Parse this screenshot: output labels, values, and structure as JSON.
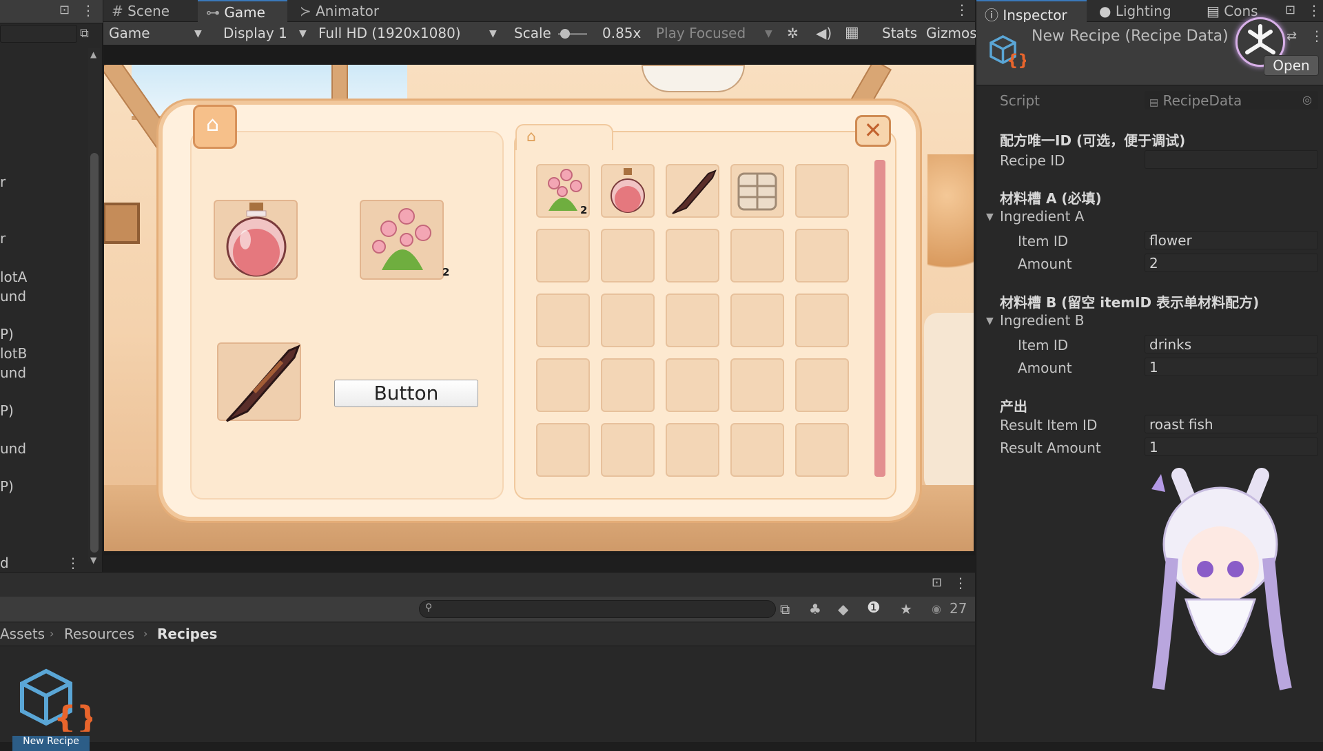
{
  "hierarchy": {
    "rows": [
      "r",
      "r",
      "lotA",
      "und",
      "P)",
      "lotB",
      "und",
      "P)",
      "und",
      "P)",
      "d"
    ]
  },
  "game_tabs": [
    {
      "label": "Scene",
      "icon": "grid-icon"
    },
    {
      "label": "Game",
      "icon": "gamepad-icon"
    },
    {
      "label": "Animator",
      "icon": "animator-icon"
    }
  ],
  "game_toolbar": {
    "view": "Game",
    "display": "Display 1",
    "resolution": "Full HD (1920x1080)",
    "scale_label": "Scale",
    "scale_value": "0.85x",
    "play_mode": "Play Focused",
    "stats": "Stats",
    "gizmos": "Gizmos"
  },
  "game": {
    "button_label": "Button",
    "craft_slots": [
      {
        "item": "potion",
        "count": ""
      },
      {
        "item": "flower",
        "count": "2"
      },
      {
        "item": "roast-fish",
        "count": ""
      }
    ],
    "inventory": [
      {
        "item": "flower",
        "count": "2"
      },
      {
        "item": "potion",
        "count": ""
      },
      {
        "item": "roast-fish",
        "count": ""
      },
      {
        "item": "crate",
        "count": ""
      }
    ],
    "inventory_cols": 5,
    "inventory_rows": 5
  },
  "project": {
    "search_placeholder": "",
    "hidden_count": "27",
    "breadcrumb": [
      "Assets",
      "Resources",
      "Recipes"
    ],
    "asset_label": "New Recipe"
  },
  "inspector": {
    "tabs": [
      {
        "label": "Inspector",
        "icon": "info-icon"
      },
      {
        "label": "Lighting",
        "icon": "bulb-icon"
      },
      {
        "label": "Cons",
        "icon": "console-icon"
      }
    ],
    "title": "New Recipe (Recipe Data)",
    "open_label": "Open",
    "script_label": "Script",
    "script_value": "RecipeData",
    "sections": {
      "id_header": "配方唯一ID (可选，便于调试)",
      "recipe_id_label": "Recipe ID",
      "recipe_id_value": "",
      "a_header": "材料槽 A (必填)",
      "a_group": "Ingredient A",
      "a_item_label": "Item ID",
      "a_item_value": "flower",
      "a_amount_label": "Amount",
      "a_amount_value": "2",
      "b_header": "材料槽 B (留空 itemID 表示单材料配方)",
      "b_group": "Ingredient B",
      "b_item_label": "Item ID",
      "b_item_value": "drinks",
      "b_amount_label": "Amount",
      "b_amount_value": "1",
      "out_header": "产出",
      "result_item_label": "Result Item ID",
      "result_item_value": "roast fish",
      "result_amount_label": "Result Amount",
      "result_amount_value": "1"
    }
  }
}
